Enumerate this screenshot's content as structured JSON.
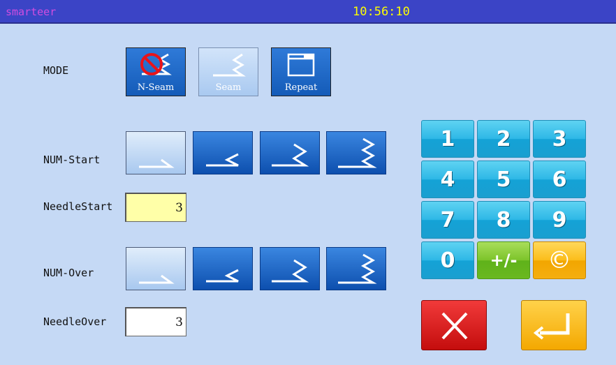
{
  "titlebar": {
    "app_name": "smarteer",
    "time": "10:56:10"
  },
  "labels": {
    "mode": "MODE",
    "num_start": "NUM-Start",
    "needle_start": "NeedleStart",
    "num_over": "NUM-Over",
    "needle_over": "NeedleOver"
  },
  "mode_buttons": [
    {
      "label": "N-Seam",
      "icon": "no-seam-icon",
      "selected": false
    },
    {
      "label": "Seam",
      "icon": "seam-icon",
      "selected": true
    },
    {
      "label": "Repeat",
      "icon": "repeat-icon",
      "selected": false
    }
  ],
  "num_start": {
    "options": [
      "stitch-1-icon",
      "stitch-2-icon",
      "stitch-3-icon",
      "stitch-4-icon"
    ],
    "selected_index": 0
  },
  "num_over": {
    "options": [
      "stitch-1-icon",
      "stitch-2-icon",
      "stitch-3-icon",
      "stitch-4-icon"
    ],
    "selected_index": 0
  },
  "fields": {
    "needle_start_value": "3",
    "needle_over_value": "3"
  },
  "keypad": {
    "keys": [
      "1",
      "2",
      "3",
      "4",
      "5",
      "6",
      "7",
      "8",
      "9",
      "0",
      "+/-",
      "©"
    ]
  },
  "actions": {
    "cancel_icon": "close-icon",
    "enter_icon": "enter-icon"
  },
  "colors": {
    "background": "#c5d9f5",
    "titlebar": "#3b44c6",
    "clock": "#ffff00",
    "app_name": "#d14de0",
    "key_cyan": "#2db7e6",
    "key_green": "#7cc42a",
    "key_orange": "#fbbd1a",
    "cancel_red": "#d61c1c"
  }
}
